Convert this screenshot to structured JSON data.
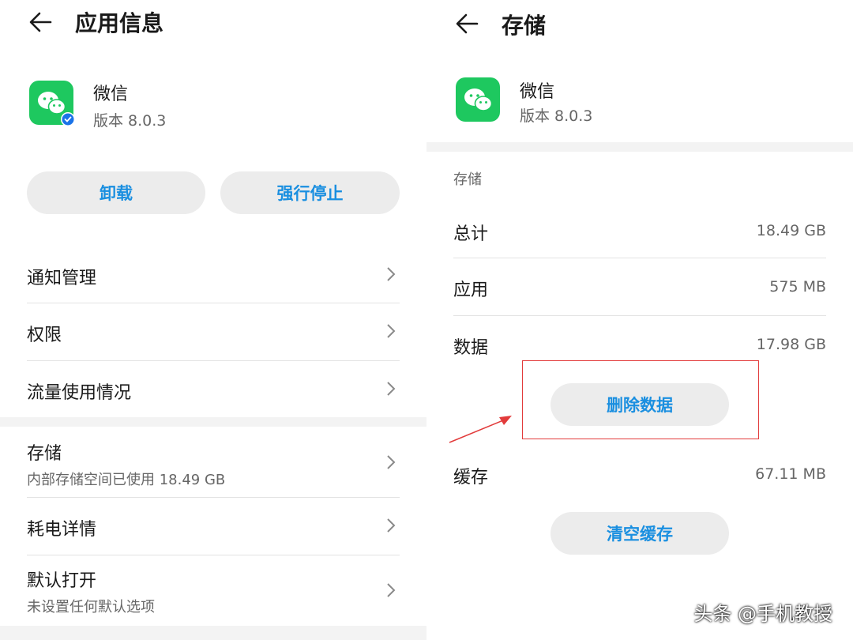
{
  "left": {
    "title": "应用信息",
    "app": {
      "name": "微信",
      "version": "版本 8.0.3"
    },
    "buttons": {
      "uninstall": "卸载",
      "force_stop": "强行停止"
    },
    "items": [
      {
        "label": "通知管理"
      },
      {
        "label": "权限"
      },
      {
        "label": "流量使用情况"
      },
      {
        "label": "存储",
        "sub": "内部存储空间已使用 18.49 GB"
      },
      {
        "label": "耗电详情"
      },
      {
        "label": "默认打开",
        "sub": "未设置任何默认选项"
      }
    ]
  },
  "right": {
    "title": "存储",
    "app": {
      "name": "微信",
      "version": "版本 8.0.3"
    },
    "section_label": "存储",
    "rows": [
      {
        "label": "总计",
        "value": "18.49 GB"
      },
      {
        "label": "应用",
        "value": "575 MB"
      },
      {
        "label": "数据",
        "value": "17.98 GB"
      },
      {
        "label": "缓存",
        "value": "67.11 MB"
      }
    ],
    "buttons": {
      "delete_data": "删除数据",
      "clear_cache": "清空缓存"
    }
  },
  "watermark": "头条 @手机教授",
  "colors": {
    "accent": "#1a8fe0",
    "wechat_green": "#1ec85f",
    "annotation_red": "#e23b3b"
  },
  "icons": [
    "back-arrow-icon",
    "wechat-app-icon",
    "verified-badge-icon",
    "chevron-right-icon"
  ]
}
